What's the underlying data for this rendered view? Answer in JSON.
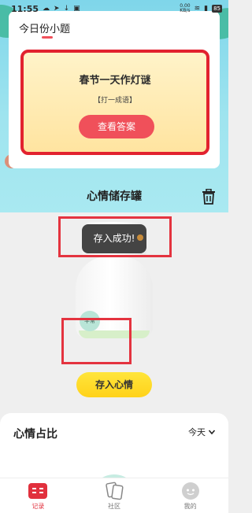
{
  "status_bar": {
    "time": "11:55",
    "network_speed_top": "0.00",
    "network_speed_bottom": "KB/s",
    "battery": "85"
  },
  "quiz": {
    "title": "今日份小题",
    "question": "春节一天作灯谜",
    "hint": "【打一成语】",
    "answer_button": "查看答案"
  },
  "jar_section": {
    "title": "心情储存罐",
    "toast": "存入成功!",
    "mood_chip": "平常",
    "save_button": "存入心情"
  },
  "ratio": {
    "title": "心情占比",
    "period": "今天"
  },
  "nav": {
    "items": [
      {
        "label": "记录",
        "active": true
      },
      {
        "label": "社区",
        "active": false
      },
      {
        "label": "我的",
        "active": false
      }
    ]
  },
  "colors": {
    "accent": "#f0505a",
    "highlight_border": "#e4333f",
    "save_button": "#ffd21a",
    "top_bg": "#9fe4ef"
  }
}
